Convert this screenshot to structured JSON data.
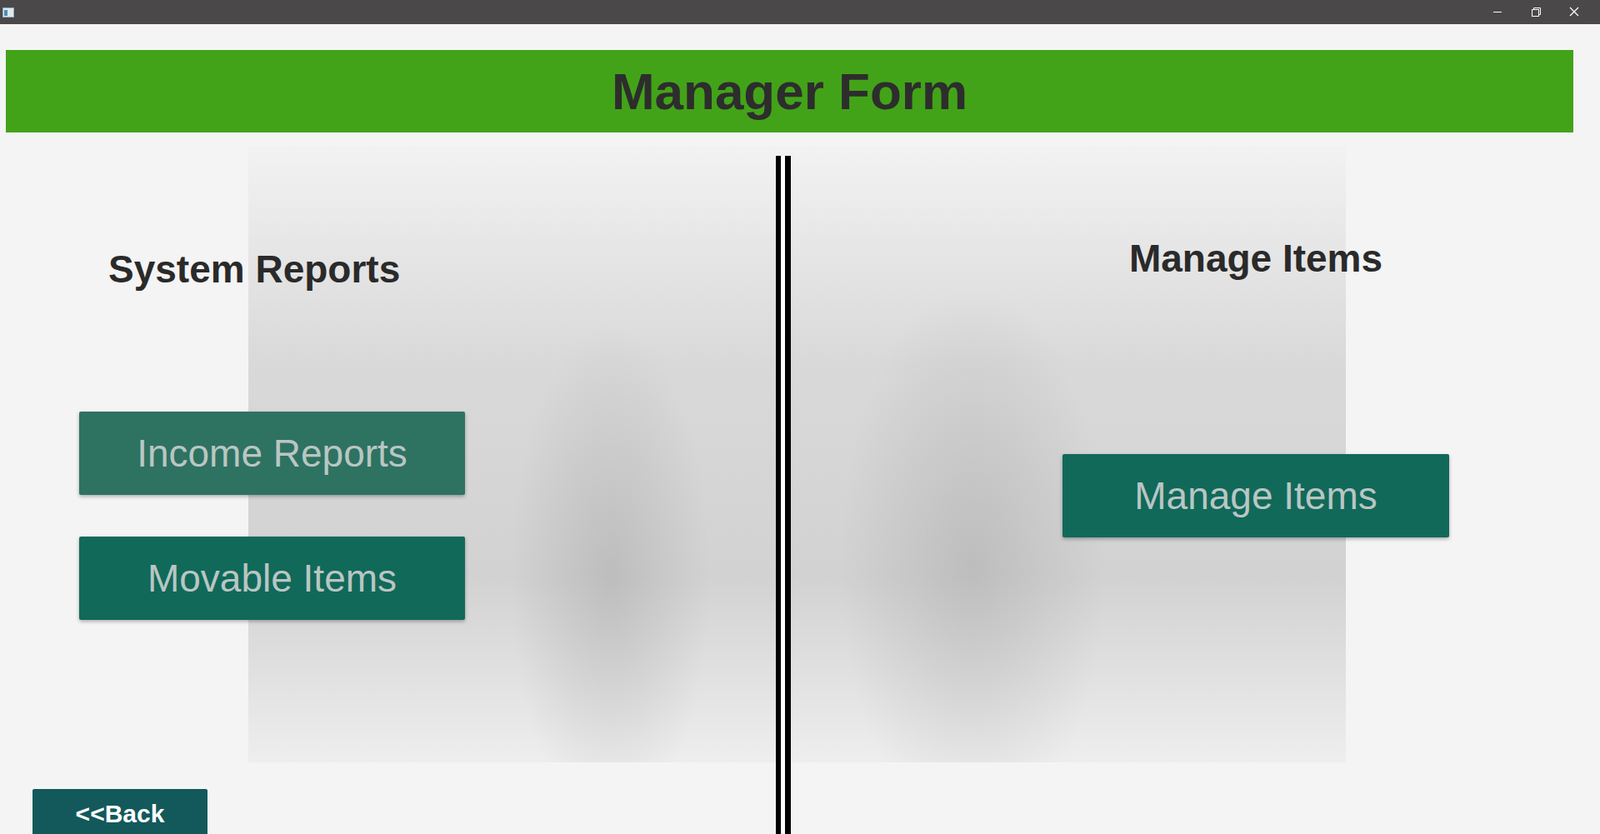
{
  "header": {
    "title": "Manager Form"
  },
  "sections": [
    {
      "heading": "System Reports",
      "buttons": [
        {
          "label": "Income Reports",
          "highlighted": true
        },
        {
          "label": "Movable Items",
          "highlighted": false
        }
      ]
    },
    {
      "heading": "Manage Items",
      "buttons": [
        {
          "label": "Manage Items",
          "highlighted": false
        }
      ]
    }
  ],
  "back_button": {
    "label": "<<Back"
  }
}
